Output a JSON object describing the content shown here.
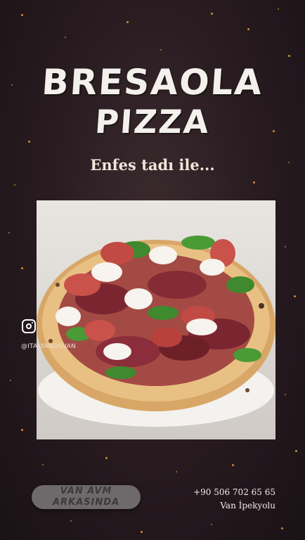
{
  "title": {
    "line1": "BRESAOLA",
    "line2": "PIZZA"
  },
  "tagline": "Enfes tadı ile...",
  "social": {
    "icon": "instagram-icon",
    "handle": "@ITALYANOSVAN"
  },
  "location_button": {
    "line1": "VAN AVM",
    "line2": "ARKASINDA"
  },
  "contact": {
    "phone": "+90 506 702 65 65",
    "area": "Van İpekyolu"
  },
  "colors": {
    "background": "#261a1f",
    "sparks": "#f0a030",
    "title": "#f4f1ec"
  }
}
